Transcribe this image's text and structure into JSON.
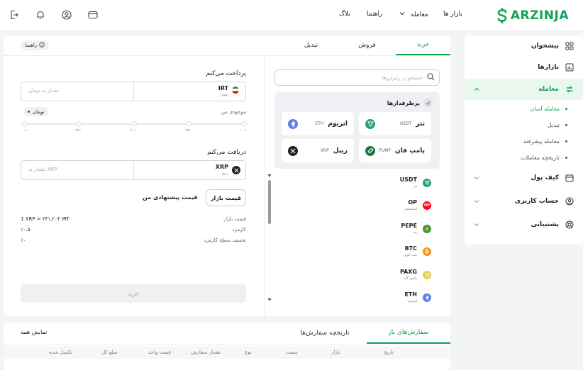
{
  "brand": {
    "name": "ARZINJA",
    "color": "#16a05a"
  },
  "nav": {
    "markets": "بازار ها",
    "trade": "معامله",
    "help": "راهنما",
    "blog": "بلاگ"
  },
  "topbar_icons": [
    "wallet-icon",
    "user-icon",
    "bell-icon",
    "exit-icon"
  ],
  "sidebar": {
    "items": [
      {
        "label": "پیشخوان",
        "icon": "dashboard-icon"
      },
      {
        "label": "بازارها",
        "icon": "chart-icon"
      },
      {
        "label": "معامله",
        "icon": "exchange-icon"
      },
      {
        "label": "کیف پول",
        "icon": "wallet-icon"
      },
      {
        "label": "حساب کاربری",
        "icon": "user-icon"
      },
      {
        "label": "پشتیبانی",
        "icon": "support-icon"
      }
    ],
    "sub_items": [
      {
        "label": "معامله آسان"
      },
      {
        "label": "تبدیل"
      },
      {
        "label": "معامله پیشرفته"
      },
      {
        "label": "تاریخچه معاملات"
      }
    ]
  },
  "trade": {
    "tabs": [
      "خرید",
      "فروش",
      "تبدیل"
    ],
    "help_label": "راهنما",
    "pay": {
      "title": "پرداخت می‌کنم",
      "currency": "IRT",
      "currency_fa": "تومان",
      "placeholder": "مقدار به تومان",
      "balance_label": "موجودی من",
      "balance_unit": "تومان"
    },
    "slider_ticks": [
      "۰٪",
      "۲۵٪",
      "۵۰٪",
      "۷۵٪",
      "۱۰۰٪"
    ],
    "receive": {
      "title": "دریافت می‌کنم",
      "currency": "XRP",
      "currency_fa": "ریپل",
      "placeholder": "مقدار به XRP"
    },
    "market_price_btn": "قیمت بازار",
    "suggested_price": "قیمت پیشنهادی من",
    "info": [
      {
        "key": "قیمت بازار",
        "value": "1 XRP = ۳۴۱,۲۰۴ IRT"
      },
      {
        "key": "کارمزد",
        "value": "٪۰.۵"
      },
      {
        "key": "تخفیف سطح کارمزد",
        "value": "٪۰"
      }
    ],
    "submit": "خرید"
  },
  "market": {
    "search_placeholder": "جستجو در رمزارزها",
    "favorites_title": "پرطرفدارها",
    "favorites": [
      {
        "name": "تتر",
        "symbol": "USDT",
        "color": "#26a17b"
      },
      {
        "name": "اتریوم",
        "symbol": "ETH",
        "color": "#627eea"
      },
      {
        "name": "پامپ فان",
        "symbol": "PUMP",
        "color": "#1f7a4a"
      },
      {
        "name": "ریپل",
        "symbol": "XRP",
        "color": "#222222"
      }
    ],
    "coins": [
      {
        "symbol": "USDT",
        "name": "تتر",
        "color": "#26a17b"
      },
      {
        "symbol": "OP",
        "name": "اپتیمیسم",
        "color": "#ff0420"
      },
      {
        "symbol": "PEPE",
        "name": "پپه",
        "color": "#4c9540"
      },
      {
        "symbol": "BTC",
        "name": "بیت کوین",
        "color": "#f7931a"
      },
      {
        "symbol": "PAXG",
        "name": "پکس گلد",
        "color": "#e4ce4d"
      },
      {
        "symbol": "ETH",
        "name": "اتریوم",
        "color": "#627eea"
      }
    ]
  },
  "orders": {
    "tabs": [
      "سفارش‌های باز",
      "تاریخچه سفارش‌ها"
    ],
    "show_all": "نمایش همه",
    "columns": [
      "تاریخ",
      "بازار",
      "سمت",
      "نوع",
      "مقدار سفارش",
      "قیمت واحد",
      "مبلغ کل",
      "تکمیل شده"
    ]
  }
}
